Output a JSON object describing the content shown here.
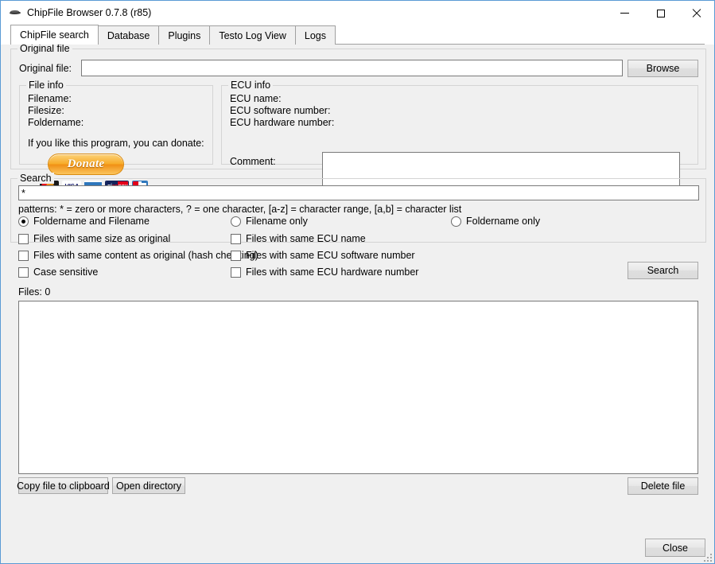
{
  "window": {
    "title": "ChipFile Browser 0.7.8 (r85)",
    "icon": "chip-icon",
    "minimize": "—",
    "maximize": "□",
    "close": "✕"
  },
  "tabs": [
    {
      "label": "ChipFile search",
      "active": true
    },
    {
      "label": "Database",
      "active": false
    },
    {
      "label": "Plugins",
      "active": false
    },
    {
      "label": "Testo Log View",
      "active": false
    },
    {
      "label": "Logs",
      "active": false
    }
  ],
  "original_file_group": {
    "title": "Original file",
    "field_label": "Original file:",
    "field_value": "",
    "field_placeholder": "",
    "browse_label": "Browse"
  },
  "file_info": {
    "title": "File info",
    "rows": [
      {
        "label": "Filename:",
        "value": ""
      },
      {
        "label": "Filesize:",
        "value": ""
      },
      {
        "label": "Foldername:",
        "value": ""
      }
    ],
    "donate_text": "If you like this program, you can donate:",
    "donate_button": "Donate",
    "cards": [
      "mastercard",
      "visa",
      "amex",
      "giropay",
      "eurocard"
    ]
  },
  "ecu_info": {
    "title": "ECU info",
    "rows": [
      {
        "label": "ECU name:",
        "value": ""
      },
      {
        "label": "ECU software number:",
        "value": ""
      },
      {
        "label": "ECU hardware number:",
        "value": ""
      }
    ],
    "comment_label": "Comment:",
    "comment_value": ""
  },
  "search_group": {
    "title": "Search",
    "query_value": "*",
    "patterns_hint": "patterns: * = zero or more characters, ? = one character, [a-z] = character range, [a,b] = character list",
    "radios": [
      {
        "label": "Foldername and Filename",
        "checked": true
      },
      {
        "label": "Filename only",
        "checked": false
      },
      {
        "label": "Foldername only",
        "checked": false
      }
    ],
    "checkboxes_left": [
      {
        "label": "Files with same size as original",
        "checked": false
      },
      {
        "label": "Files with same content as original (hash checking)",
        "checked": false
      },
      {
        "label": "Case sensitive",
        "checked": false
      }
    ],
    "checkboxes_right": [
      {
        "label": "Files with same ECU name",
        "checked": false
      },
      {
        "label": "Files with same ECU software number",
        "checked": false
      },
      {
        "label": "Files with same ECU hardware number",
        "checked": false
      }
    ],
    "search_button": "Search"
  },
  "results": {
    "count_label": "Files: 0",
    "items": [],
    "copy_button": "Copy file to clipboard",
    "open_dir_button": "Open directory",
    "delete_button": "Delete file"
  },
  "footer": {
    "close_button": "Close"
  },
  "colors": {
    "window_border": "#5a9bd5",
    "client_bg": "#f0f0f0",
    "group_border": "#d4d4d4",
    "field_border": "#7a7a7a",
    "donate_orange": "#f7ab28"
  }
}
